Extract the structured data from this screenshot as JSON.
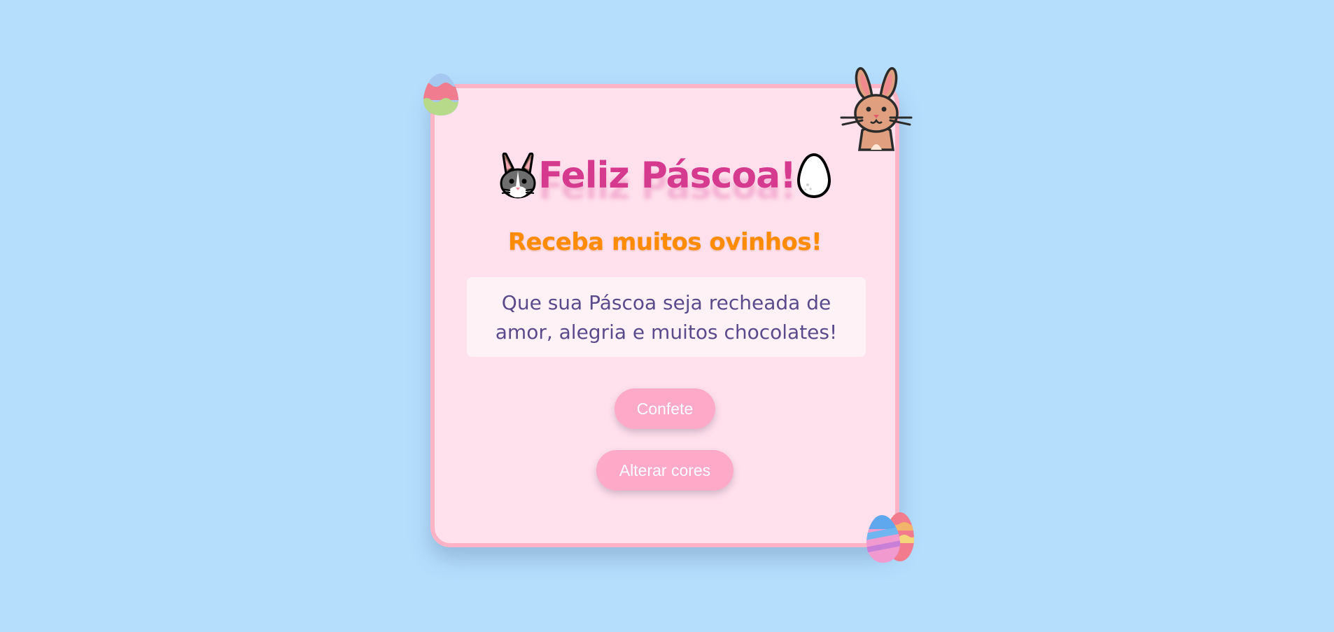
{
  "card": {
    "title": "Feliz Páscoa!",
    "subtitle": "Receba muitos ovinhos!",
    "message": "Que sua Páscoa seja recheada de amor, alegria e muitos chocolates!"
  },
  "buttons": {
    "confete_label": "Confete",
    "alterar_cores_label": "Alterar cores"
  },
  "icons": {
    "title_left": "rabbit-face-icon",
    "title_right": "egg-icon",
    "top_left": "easter-egg-icon",
    "top_right": "bunny-icon",
    "bottom_right": "easter-eggs-pair-icon"
  },
  "colors": {
    "background": "#b5ddfc",
    "card": "#ffe0ec",
    "card_border": "#ffb3c6",
    "title": "#d63a8f",
    "subtitle": "#ff8c00",
    "message": "#5a4a8c",
    "button": "#ffa9c8"
  }
}
